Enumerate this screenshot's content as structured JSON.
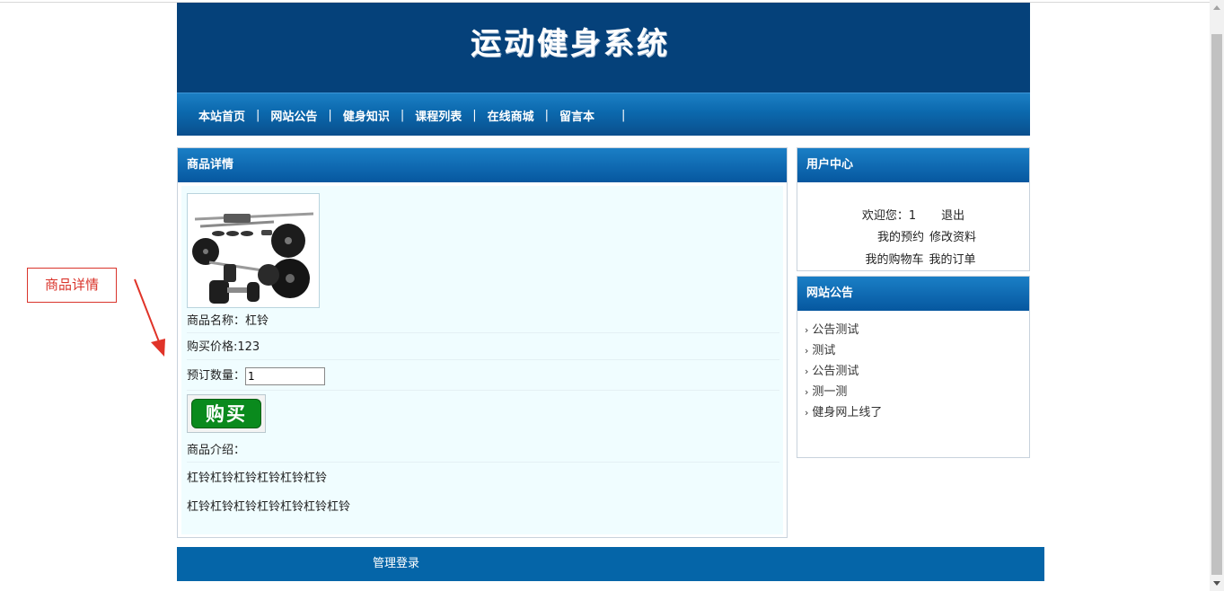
{
  "site": {
    "title": "运动健身系统"
  },
  "nav": {
    "items": [
      "本站首页",
      "网站公告",
      "健身知识",
      "课程列表",
      "在线商城",
      "留言本"
    ],
    "separator": "|"
  },
  "product_panel": {
    "header": "商品详情",
    "name_label": "商品名称：",
    "name_value": "杠铃",
    "price_label": "购买价格:",
    "price_value": "123",
    "qty_label": "预订数量：",
    "qty_value": "1",
    "buy_label": "购买",
    "intro_label": "商品介绍：",
    "intro_lines": [
      "杠铃杠铃杠铃杠铃杠铃杠铃",
      "杠铃杠铃杠铃杠铃杠铃杠铃杠铃"
    ]
  },
  "user_panel": {
    "header": "用户中心",
    "welcome_label": "欢迎您：",
    "username": "1",
    "logout": "退出",
    "my_booking": "我的预约",
    "edit_profile": "修改资料",
    "my_cart": "我的购物车",
    "my_orders": "我的订单"
  },
  "notice_panel": {
    "header": "网站公告",
    "items": [
      "公告测试",
      "测试",
      "公告测试",
      "测一测",
      "健身网上线了"
    ]
  },
  "footer": {
    "admin_login": "管理登录"
  },
  "annotation": {
    "label": "商品详情",
    "color": "#d9342b"
  },
  "colors": {
    "banner": "#05417a",
    "nav": "#0b68ad",
    "panel_header": "#1a7fc6",
    "buy_button": "#0a8a1d",
    "content_bg": "#f0fdff"
  }
}
